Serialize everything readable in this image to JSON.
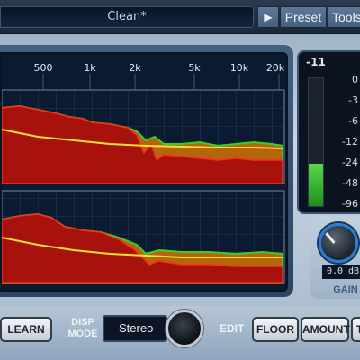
{
  "header": {
    "preset_name": "Clean*",
    "play_symbol": "▶",
    "preset_label": "Preset",
    "tools_label": "Tools"
  },
  "display": {
    "freq_labels": [
      "500",
      "1k",
      "2k",
      "5k",
      "10k",
      "20k"
    ]
  },
  "meter": {
    "peak": "-11",
    "ticks": [
      "0",
      "-3",
      "-6",
      "-12",
      "-24",
      "-48",
      "-96"
    ],
    "level_fraction": 0.33
  },
  "gain": {
    "value": "0.0 dB",
    "label": "GAIN"
  },
  "bottom": {
    "learn_label": "LEARN",
    "disp_mode_line1": "DISP",
    "disp_mode_line2": "MODE",
    "disp_mode_value": "Stereo",
    "edit_label": "EDIT",
    "floor_label": "FLOOR",
    "amount_label": "AMOUNT",
    "t_label": "T"
  },
  "colors": {
    "noise": "#b3120e",
    "noise_edge": "#ff2a1c",
    "signal_band": "#c06c0a",
    "signal_edge": "#35d02c",
    "threshold_line": "#f4e32a"
  }
}
